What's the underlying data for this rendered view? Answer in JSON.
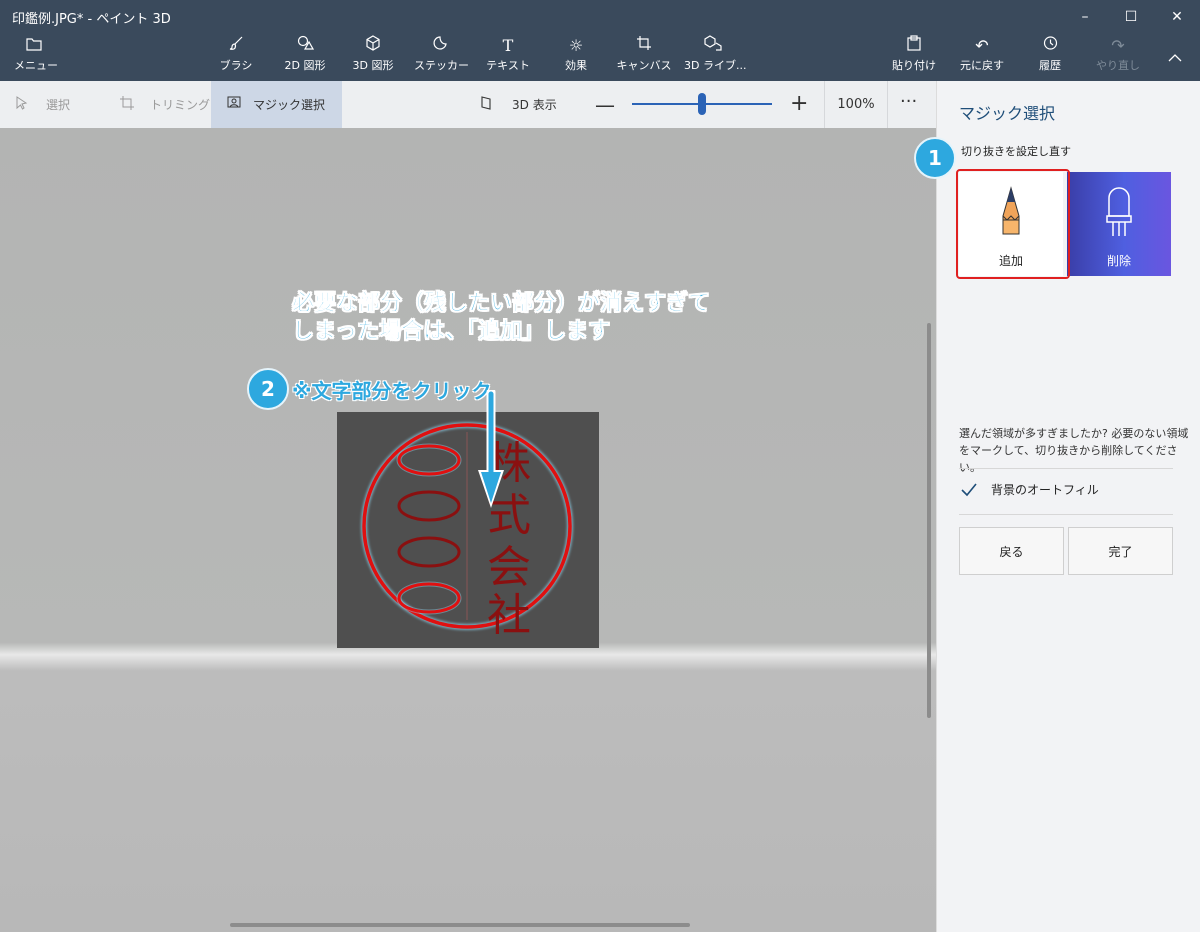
{
  "window": {
    "title": "印鑑例.JPG* - ペイント 3D",
    "minimize_glyph": "–",
    "maximize_glyph": "☐",
    "close_glyph": "✕"
  },
  "ribbon": {
    "menu": "メニュー",
    "brush": "ブラシ",
    "shapes_2d": "2D 図形",
    "shapes_3d": "3D 図形",
    "stickers": "ステッカー",
    "text": "テキスト",
    "effects": "効果",
    "canvas": "キャンバス",
    "library_3d": "3D ライブ...",
    "paste": "貼り付け",
    "undo": "元に戻す",
    "history": "履歴",
    "redo": "やり直し",
    "icons": [
      "folder-icon",
      "brush-icon",
      "shapes-2d-icon",
      "cube-icon",
      "sticker-icon",
      "text-icon",
      "sun-icon",
      "crop-icon",
      "library-icon",
      "paste-icon",
      "undo-icon",
      "history-icon",
      "redo-icon",
      "chevron-up-icon"
    ]
  },
  "toolbar": {
    "select": "選択",
    "crop": "トリミング",
    "magic_select": "マジック選択",
    "view_3d": "3D 表示",
    "zoom": "100%",
    "zoom_level": 0.5,
    "more": "···"
  },
  "canvas": {
    "annotation": "必要な部分（残したい部分）が消えすぎて\nしまった場合は、「追加」します",
    "step2_text": "※文字部分をクリック",
    "badge1": "1",
    "badge2": "2",
    "stamp": {
      "left_chars": [
        "〇",
        "〇",
        "〇",
        "〇"
      ],
      "right_chars": [
        "株",
        "式",
        "会",
        "社"
      ]
    }
  },
  "panel": {
    "title": "マジック選択",
    "subtitle": "切り抜きを設定し直す",
    "add": "追加",
    "remove": "削除",
    "note": "選んだ領域が多すぎましたか? 必要のない領域をマークして、切り抜きから削除してください。",
    "autofill": "背景のオートフィル",
    "autofill_checked": true,
    "back": "戻る",
    "done": "完了"
  },
  "colors": {
    "chrome": "#3a4a5c",
    "accent": "#2da8df",
    "stamp_red": "#e01010",
    "selection_red": "#e02020"
  }
}
